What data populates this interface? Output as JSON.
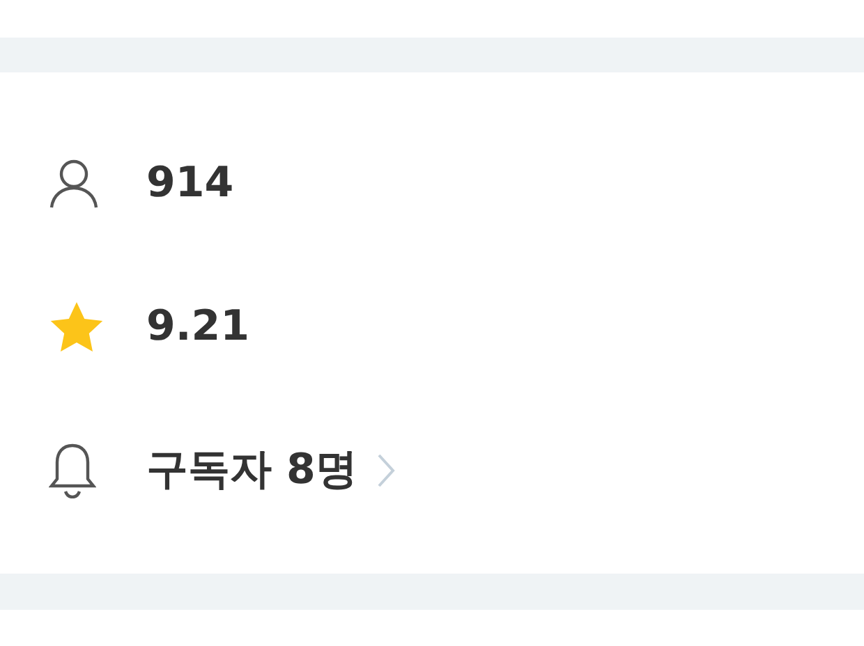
{
  "stats": [
    {
      "kind": "user",
      "text": "914",
      "link": false
    },
    {
      "kind": "star",
      "text": "9.21",
      "link": false
    },
    {
      "kind": "bell",
      "text": "구독자 8명",
      "link": true
    }
  ]
}
